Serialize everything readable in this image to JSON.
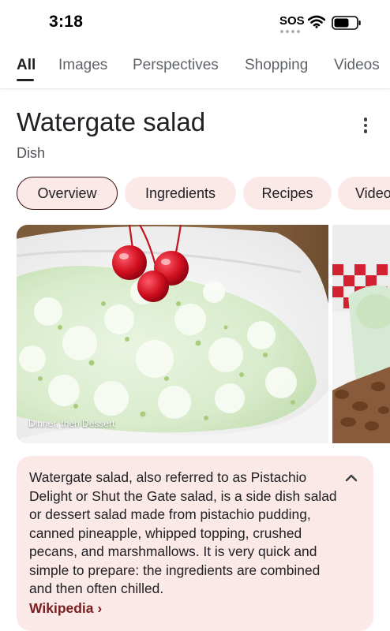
{
  "status": {
    "time": "3:18",
    "sos": "SOS"
  },
  "tabs": [
    {
      "label": "All",
      "active": true
    },
    {
      "label": "Images"
    },
    {
      "label": "Perspectives"
    },
    {
      "label": "Shopping"
    },
    {
      "label": "Videos"
    }
  ],
  "entity": {
    "title": "Watergate salad",
    "subtitle": "Dish"
  },
  "chips": [
    {
      "label": "Overview",
      "selected": true
    },
    {
      "label": "Ingredients"
    },
    {
      "label": "Recipes"
    },
    {
      "label": "Videos"
    }
  ],
  "images": {
    "main_caption": "Dinner, then Dessert"
  },
  "description": {
    "text": "Watergate salad, also referred to as Pistachio Delight or Shut the Gate salad, is a side dish salad or dessert salad made from pistachio pudding, canned pineapple, whipped topping, crushed pecans, and marshmallows. It is very quick and simple to prepare: the ingredients are combined and then often chilled.",
    "source_label": "Wikipedia",
    "source_arrow": "›"
  },
  "colors": {
    "chip_bg": "#fbe9e7",
    "card_bg": "#fbe9e7",
    "link": "#7a1f1f",
    "selected_border": "#3b1212"
  },
  "icons": {
    "wifi": "wifi-icon",
    "battery": "battery-icon",
    "more": "more-vert-icon",
    "collapse": "chevron-up-icon"
  }
}
